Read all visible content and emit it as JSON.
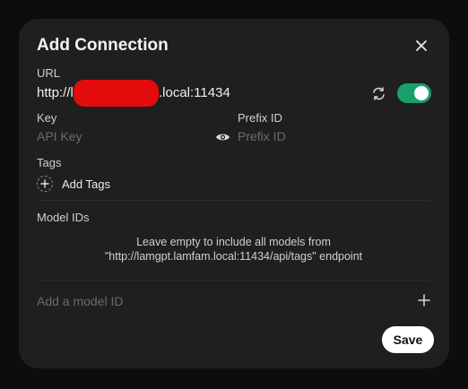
{
  "dialog": {
    "title": "Add Connection",
    "close_icon": "close-icon"
  },
  "url": {
    "label": "URL",
    "value_prefix": "http://l",
    "value_suffix": ".local:11434",
    "refresh_icon": "refresh-icon",
    "enabled": true,
    "toggle_color": "#19a06a",
    "redaction_color": "#e30b0b"
  },
  "key": {
    "label": "Key",
    "placeholder": "API Key",
    "visibility_icon": "eye-icon"
  },
  "prefix": {
    "label": "Prefix ID",
    "placeholder": "Prefix ID"
  },
  "tags": {
    "label": "Tags",
    "add_label": "Add Tags"
  },
  "models": {
    "label": "Model IDs",
    "hint_line1": "Leave empty to include all models from",
    "hint_line2": "\"http://lamgpt.lamfam.local:11434/api/tags\" endpoint",
    "input_placeholder": "Add a model ID",
    "add_icon": "plus-icon"
  },
  "actions": {
    "save_label": "Save"
  }
}
